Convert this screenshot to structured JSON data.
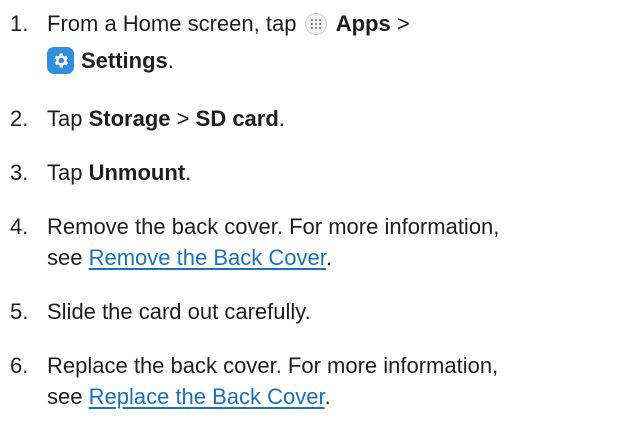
{
  "steps": [
    {
      "number": "1.",
      "line1_prefix": "From a Home screen, tap",
      "apps_label": "Apps",
      "separator": ">",
      "settings_label": "Settings",
      "end": ".",
      "apps_icon": "apps-grid-icon",
      "settings_icon": "gear-icon"
    },
    {
      "number": "2.",
      "prefix": "Tap",
      "storage_label": "Storage",
      "separator": ">",
      "sdcard_label": "SD card",
      "end": "."
    },
    {
      "number": "3.",
      "prefix": "Tap",
      "unmount_label": "Unmount",
      "end": "."
    },
    {
      "number": "4.",
      "line1": "Remove the back cover. For more information,",
      "see": "see",
      "link": "Remove the Back Cover",
      "end": "."
    },
    {
      "number": "5.",
      "text": "Slide the card out carefully."
    },
    {
      "number": "6.",
      "line1": "Replace the back cover. For more information,",
      "see": "see",
      "link": "Replace the Back Cover",
      "end": "."
    }
  ],
  "colors": {
    "text": "#1e1e1e",
    "link": "#1a73b8",
    "settings_icon_bg": "#2f8fdc"
  }
}
